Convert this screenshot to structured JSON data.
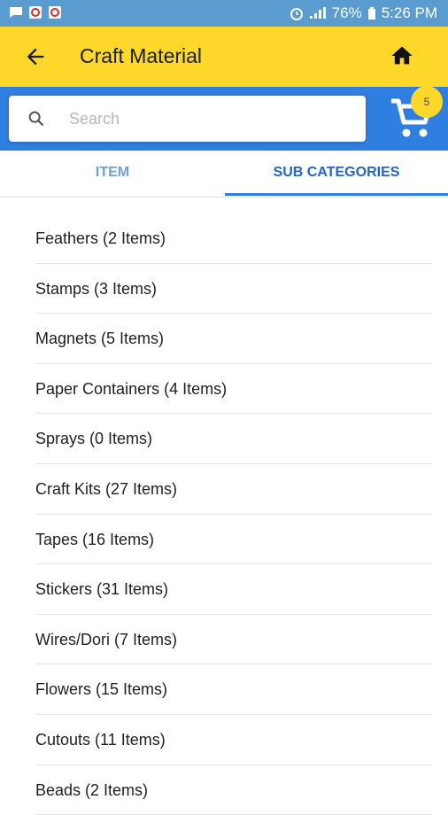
{
  "status_bar": {
    "battery": "76%",
    "time": "5:26 PM"
  },
  "app_bar": {
    "title": "Craft Material"
  },
  "search": {
    "placeholder": "Search"
  },
  "cart": {
    "badge_count": "5"
  },
  "tabs": {
    "item": "ITEM",
    "sub_categories": "SUB CATEGORIES",
    "selected": "SUB CATEGORIES"
  },
  "subcategories": [
    "Feathers (2 Items)",
    "Stamps (3 Items)",
    "Magnets (5 Items)",
    "Paper Containers (4 Items)",
    "Sprays (0 Items)",
    "Craft Kits (27 Items)",
    "Tapes (16 Items)",
    "Stickers (31 Items)",
    "Wires/Dori (7 Items)",
    "Flowers (15 Items)",
    "Cutouts (11 Items)",
    "Beads (2 Items)"
  ],
  "colors": {
    "status_bar": "#5a9bd0",
    "app_bar": "#fdd72a",
    "search_band": "#2f7fe0",
    "tab_active": "#2466c4"
  }
}
